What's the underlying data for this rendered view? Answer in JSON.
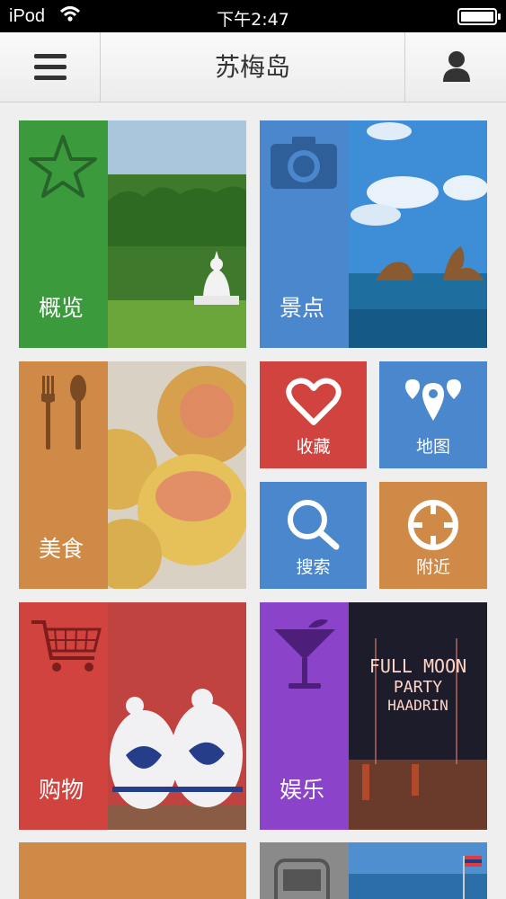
{
  "status_bar": {
    "carrier": "iPod",
    "time": "下午2:47"
  },
  "nav": {
    "title": "苏梅岛"
  },
  "tiles": {
    "overview": {
      "label": "概览",
      "icon": "star-icon",
      "color": "#3a9a3c"
    },
    "sights": {
      "label": "景点",
      "icon": "camera-icon",
      "color": "#4a87cc"
    },
    "food": {
      "label": "美食",
      "icon": "fork-spoon-icon",
      "color": "#d08a47"
    },
    "favorites": {
      "label": "收藏",
      "icon": "heart-icon",
      "color": "#d0433f"
    },
    "map": {
      "label": "地图",
      "icon": "map-pin-icon",
      "color": "#4a87cc"
    },
    "search": {
      "label": "搜索",
      "icon": "search-icon",
      "color": "#4a87cc"
    },
    "nearby": {
      "label": "附近",
      "icon": "crosshair-icon",
      "color": "#d08a47"
    },
    "shopping": {
      "label": "购物",
      "icon": "cart-icon",
      "color": "#d0433f"
    },
    "entertainment": {
      "label": "娱乐",
      "icon": "cocktail-icon",
      "color": "#8b44c9"
    },
    "partial_left": {
      "color": "#d08a47"
    },
    "partial_right": {
      "icon": "bus-icon",
      "color": "#8a8a8a"
    }
  },
  "photo_signs": {
    "party_line1": "FULL MOON",
    "party_line2": "PARTY",
    "party_line3": "HAADRIN"
  }
}
